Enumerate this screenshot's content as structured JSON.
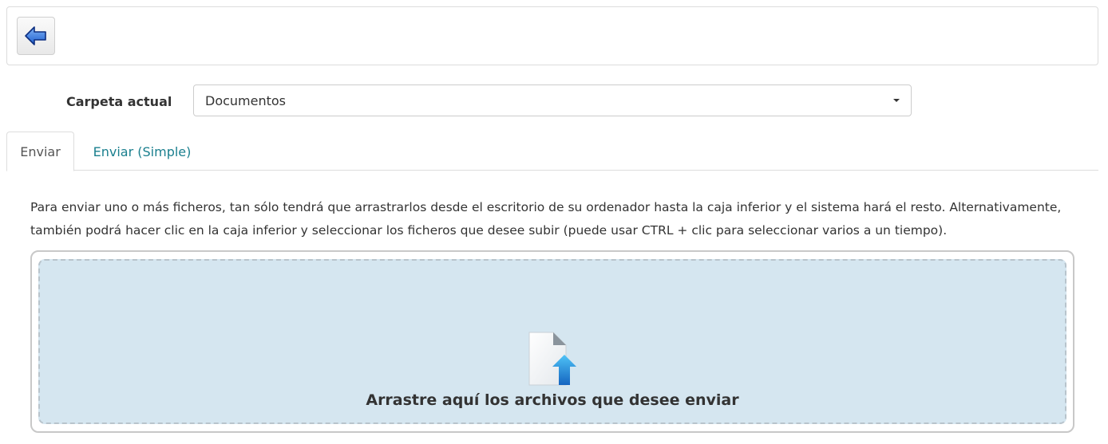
{
  "toolbar": {
    "back_icon": "back-arrow-icon"
  },
  "folder": {
    "label": "Carpeta actual",
    "selected": "Documentos"
  },
  "tabs": [
    {
      "label": "Enviar",
      "active": true
    },
    {
      "label": "Enviar (Simple)",
      "active": false
    }
  ],
  "instructions": "Para enviar uno o más ficheros, tan sólo tendrá que arrastrarlos desde el escritorio de su ordenador hasta la caja inferior y el sistema hará el resto. Alternativamente, también podrá hacer clic en la caja inferior y seleccionar los ficheros que desee subir (puede usar CTRL + clic para seleccionar varios a un tiempo).",
  "dropzone": {
    "text": "Arrastre aquí los archivos que desee enviar",
    "icon": "file-upload-icon"
  },
  "colors": {
    "dropzone_bg": "#d5e6f0",
    "link_tab": "#1a7f8e",
    "arrow_blue": "#2a6fd6"
  }
}
